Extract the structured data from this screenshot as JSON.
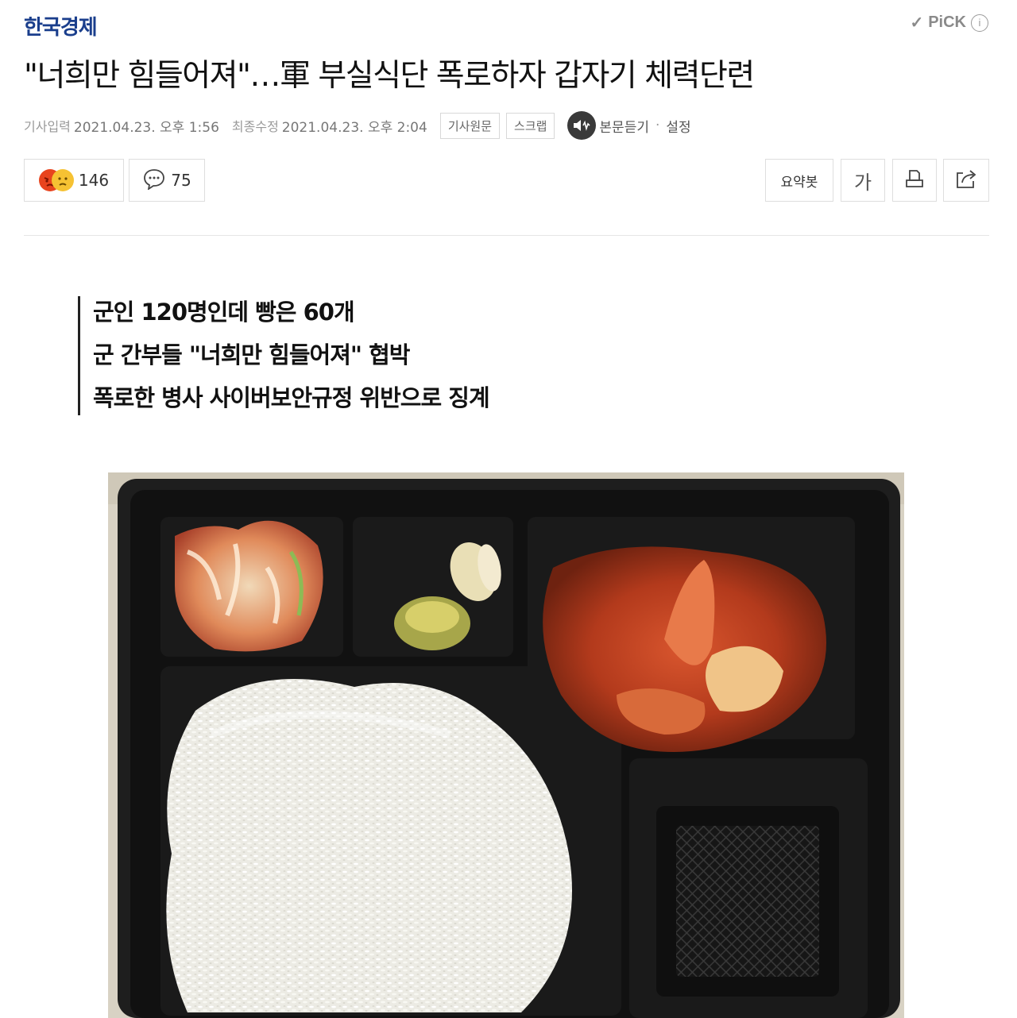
{
  "header": {
    "press_name": "한국경제",
    "pick_label": "PiCK",
    "info_glyph": "i"
  },
  "article": {
    "title": "\"너희만 힘들어져\"…軍 부실식단 폭로하자 갑자기 체력단련",
    "published_label": "기사입력",
    "published_value": "2021.04.23. 오후 1:56",
    "modified_label": "최종수정",
    "modified_value": "2021.04.23. 오후 2:04",
    "original_button": "기사원문",
    "scrap_button": "스크랩",
    "listen_label": "본문듣기",
    "settings_label": "설정",
    "summary_lines": [
      "군인 120명인데 빵은 60개",
      "군 간부들 \"너희만 힘들어져\" 협박",
      "폭로한 병사 사이버보안규정 위반으로 징계"
    ]
  },
  "toolbar": {
    "reaction_count": "146",
    "comment_count": "75",
    "summary_bot_label": "요약봇",
    "font_size_label": "가",
    "icons": {
      "reaction": "angry-sad-faces-icon",
      "comment": "speech-bubble-icon",
      "print": "print-icon",
      "share": "share-icon",
      "speaker": "speaker-icon"
    }
  },
  "colors": {
    "press_logo": "#1a3e8c",
    "angry_face": "#e8441e",
    "sad_face": "#f6c233",
    "meta_text": "#888888"
  },
  "photo": {
    "subject": "military meal tray with rice, kimchi, pickles and spicy chicken stew"
  }
}
